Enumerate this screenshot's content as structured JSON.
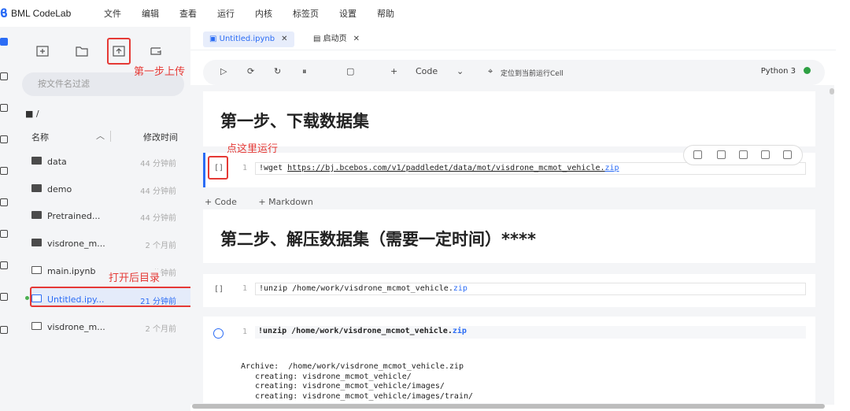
{
  "app": {
    "name": "BML CodeLab"
  },
  "menu": [
    "文件",
    "编辑",
    "查看",
    "运行",
    "内核",
    "标签页",
    "设置",
    "帮助"
  ],
  "file_panel": {
    "filter_placeholder": "按文件名过滤",
    "breadcrumb": "■ /",
    "col_name": "名称",
    "col_modified": "修改时间",
    "items": [
      {
        "name": "data",
        "modified": "44 分钟前",
        "type": "folder"
      },
      {
        "name": "demo",
        "modified": "44 分钟前",
        "type": "folder"
      },
      {
        "name": "Pretrained...",
        "modified": "44 分钟前",
        "type": "folder"
      },
      {
        "name": "visdrone_m...",
        "modified": "2 个月前",
        "type": "folder"
      },
      {
        "name": "main.ipynb",
        "modified": "44 分钟前",
        "type": "notebook"
      },
      {
        "name": "Untitled.ipy...",
        "modified": "21 分钟前",
        "type": "notebook",
        "selected": true
      },
      {
        "name": "visdrone_m...",
        "modified": "2 个月前",
        "type": "markdown"
      }
    ]
  },
  "annotations": {
    "upload": "第一步上传",
    "run_here": "点这里运行",
    "open_dir": "打开后目录"
  },
  "tabs": [
    {
      "label": "Untitled.ipynb",
      "active": true
    },
    {
      "label": "启动页",
      "active": false
    }
  ],
  "notebook_toolbar": {
    "cell_type": "Code",
    "locate_label": "定位到当前运行Cell",
    "kernel": "Python 3"
  },
  "cells": {
    "md1": "第一步、下载数据集",
    "code1": {
      "prompt": "[]",
      "line": "1",
      "text_prefix": "!wget ",
      "url": "https://bj.bcebos.com/v1/paddledet/data/mot/visdrone_mcmot_vehicle.",
      "ext": "zip"
    },
    "add_code": "+ Code",
    "add_markdown": "+ Markdown",
    "md2": "第二步、解压数据集（需要一定时间）****",
    "code2": {
      "prompt": "[]",
      "line": "1",
      "text": "!unzip /home/work/visdrone_mcmot_vehicle.",
      "ext": "zip"
    },
    "code3": {
      "line": "1",
      "text": "!unzip /home/work/visdrone_mcmot_vehicle.",
      "ext": "zip"
    },
    "output": [
      "Archive:  /home/work/visdrone_mcmot_vehicle.zip",
      "   creating: visdrone_mcmot_vehicle/",
      "   creating: visdrone_mcmot_vehicle/images/",
      "   creating: visdrone_mcmot_vehicle/images/train/"
    ]
  },
  "colors": {
    "accent": "#2b6cf5",
    "annotation": "#e53935",
    "kernel_ok": "#2ea043"
  }
}
